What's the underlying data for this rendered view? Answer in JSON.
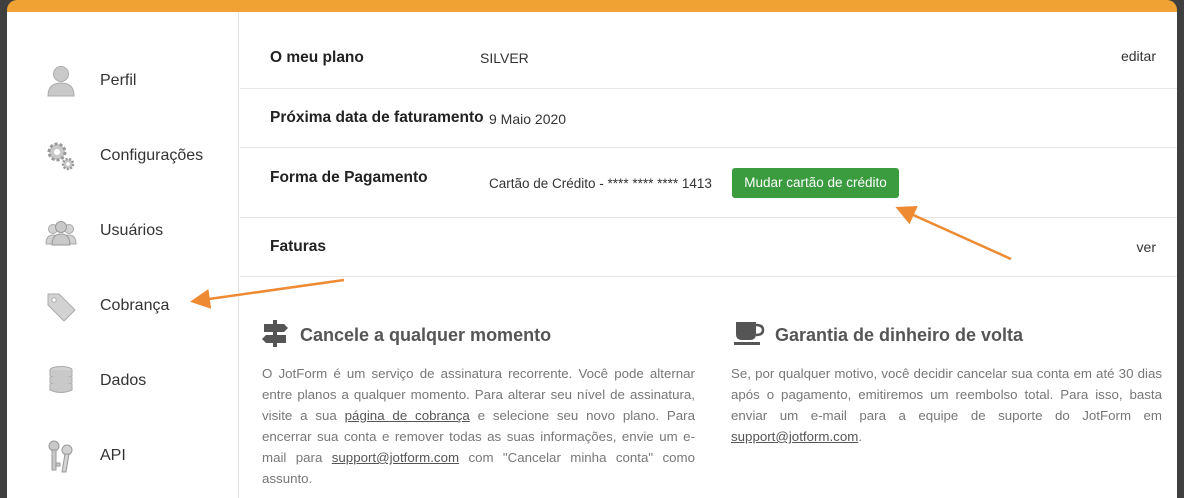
{
  "sidebar": {
    "items": [
      {
        "label": "Perfil",
        "icon": "user-icon"
      },
      {
        "label": "Configurações",
        "icon": "gears-icon"
      },
      {
        "label": "Usuários",
        "icon": "users-icon"
      },
      {
        "label": "Cobrança",
        "icon": "tag-icon"
      },
      {
        "label": "Dados",
        "icon": "database-icon"
      },
      {
        "label": "API",
        "icon": "keys-icon"
      }
    ]
  },
  "plan": {
    "label": "O meu plano",
    "value": "SILVER",
    "edit_link": "editar"
  },
  "billing_date": {
    "label": "Próxima data de faturamento",
    "value": "9 Maio 2020"
  },
  "payment": {
    "label": "Forma de Pagamento",
    "card_text": "Cartão de Crédito - **** **** **** 1413",
    "change_button": "Mudar cartão de crédito"
  },
  "invoices": {
    "label": "Faturas",
    "view_link": "ver"
  },
  "cancel_info": {
    "title": "Cancele a qualquer momento",
    "text_1": "O JotForm é um serviço de assinatura recorrente. Você pode alternar entre planos a qualquer momento. Para alterar seu nível de assinatura, visite a sua ",
    "link_billing": "página de cobrança",
    "text_2": " e selecione seu novo plano. Para encerrar sua conta e remover todas as suas informações, envie um e-mail para ",
    "link_support": "support@jotform.com",
    "text_3": " com \"Cancelar minha conta\" como assunto."
  },
  "money_back": {
    "title": "Garantia de dinheiro de volta",
    "text_1": "Se, por qualquer motivo, você decidir cancelar sua conta em até 30 dias após o pagamento, emitiremos um reembolso total. Para isso, basta enviar um e-mail para a equipe de suporte do JotForm em ",
    "link_support": "support@jotform.com",
    "text_2": "."
  },
  "colors": {
    "accent": "#f0a233",
    "button_green": "#3a9b3f",
    "annotation_arrow": "#ee8a32"
  }
}
